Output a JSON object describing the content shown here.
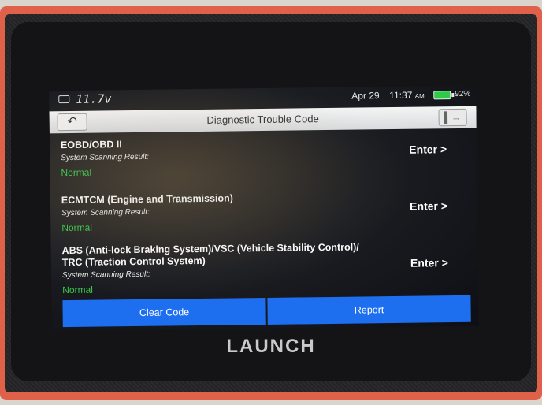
{
  "status_bar": {
    "voltage": "11.7v",
    "date": "Apr 29",
    "time": "11:37",
    "time_suffix": "AM",
    "battery_percent": "92%"
  },
  "title_bar": {
    "back_icon": "return-arrow-icon",
    "title": "Diagnostic Trouble Code",
    "exit_icon": "exit-door-icon"
  },
  "systems": [
    {
      "name": "EOBD/OBD II",
      "scan_label": "System Scanning Result:",
      "status": "Normal",
      "enter_label": "Enter >"
    },
    {
      "name": "ECMTCM (Engine and Transmission)",
      "scan_label": "System Scanning Result:",
      "status": "Normal",
      "enter_label": "Enter >"
    },
    {
      "name": "ABS (Anti-lock Braking System)/VSC (Vehicle Stability Control)/\nTRC (Traction Control System)",
      "scan_label": "System Scanning Result:",
      "status": "Normal",
      "enter_label": "Enter >"
    }
  ],
  "actions": {
    "clear_code": "Clear Code",
    "report": "Report"
  },
  "device": {
    "brand": "LAUNCH"
  },
  "colors": {
    "accent": "#1e6ef0",
    "status_ok": "#37c94a",
    "device_frame": "#e0614a"
  }
}
